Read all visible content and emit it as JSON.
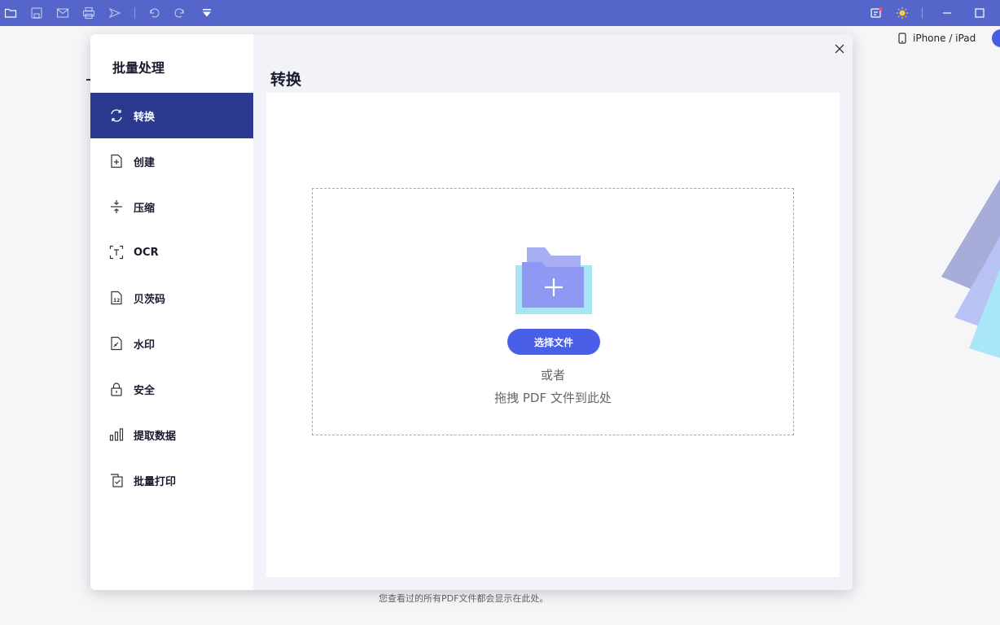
{
  "toolbar": {
    "icons": [
      "folder-icon",
      "save-icon",
      "mail-icon",
      "print-icon",
      "share-icon",
      "undo-icon",
      "redo-icon",
      "dropdown-icon",
      "notification-icon",
      "theme-icon",
      "minimize-icon",
      "maximize-icon"
    ]
  },
  "background": {
    "device_label": "iPhone / iPad",
    "footer_text": "您查看过的所有PDF文件都会显示在此处。"
  },
  "dialog": {
    "sidebar_title": "批量处理",
    "nav_items": [
      {
        "label": "转换",
        "icon": "convert-icon",
        "active": true
      },
      {
        "label": "创建",
        "icon": "create-icon",
        "active": false
      },
      {
        "label": "压缩",
        "icon": "compress-icon",
        "active": false
      },
      {
        "label": "OCR",
        "icon": "ocr-icon",
        "active": false
      },
      {
        "label": "贝茨码",
        "icon": "bates-icon",
        "active": false
      },
      {
        "label": "水印",
        "icon": "watermark-icon",
        "active": false
      },
      {
        "label": "安全",
        "icon": "lock-icon",
        "active": false
      },
      {
        "label": "提取数据",
        "icon": "chart-icon",
        "active": false
      },
      {
        "label": "批量打印",
        "icon": "print-batch-icon",
        "active": false
      }
    ],
    "content_title": "转换",
    "dropzone": {
      "select_button": "选择文件",
      "or_text": "或者",
      "drag_text": "拖拽 PDF 文件到此处"
    }
  },
  "colors": {
    "toolbar": "#5665c9",
    "active_nav": "#2b3a8f",
    "primary_button": "#4a5fe8"
  }
}
